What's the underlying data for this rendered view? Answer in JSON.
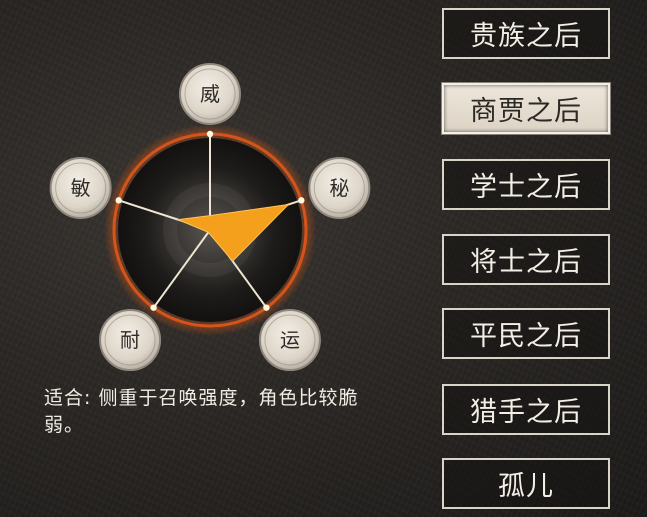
{
  "radar": {
    "stats": [
      {
        "key": "wei",
        "label": "威",
        "value": 0.15
      },
      {
        "key": "mi",
        "label": "秘",
        "value": 0.86
      },
      {
        "key": "yun",
        "label": "运",
        "value": 0.4
      },
      {
        "key": "nai",
        "label": "耐",
        "value": 0.03
      },
      {
        "key": "min",
        "label": "敏",
        "value": 0.35
      }
    ],
    "fill_color": "#f4a01c",
    "ring_color": "#d4541a"
  },
  "description": {
    "text": "适合: 侧重于召唤强度，角色比较脆弱。"
  },
  "origins": [
    {
      "label": "贵族之后",
      "selected": false
    },
    {
      "label": "商贾之后",
      "selected": true
    },
    {
      "label": "学士之后",
      "selected": false
    },
    {
      "label": "将士之后",
      "selected": false
    },
    {
      "label": "平民之后",
      "selected": false
    },
    {
      "label": "猎手之后",
      "selected": false
    },
    {
      "label": "孤儿",
      "selected": false
    }
  ]
}
